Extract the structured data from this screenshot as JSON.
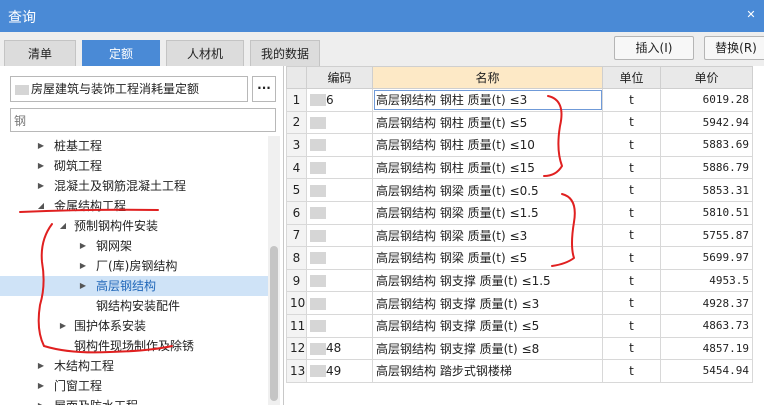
{
  "window": {
    "title": "查询",
    "close_icon": "close-icon"
  },
  "tabs": [
    {
      "label": "清单",
      "active": false
    },
    {
      "label": "定额",
      "active": true
    },
    {
      "label": "人材机",
      "active": false
    },
    {
      "label": "我的数据",
      "active": false
    }
  ],
  "toolbar": {
    "insert_label": "插入(I)",
    "replace_label": "替换(R)"
  },
  "library": {
    "selected": "房屋建筑与装饰工程消耗量定额",
    "more_label": "···"
  },
  "search": {
    "value": "钢"
  },
  "tree": {
    "nodes": [
      {
        "label": "桩基工程",
        "expanded": false
      },
      {
        "label": "砌筑工程",
        "expanded": false
      },
      {
        "label": "混凝土及钢筋混凝土工程",
        "expanded": false
      },
      {
        "label": "金属结构工程",
        "expanded": true
      },
      {
        "label": "预制钢构件安装",
        "expanded": true
      },
      {
        "label": "钢网架",
        "expanded": false
      },
      {
        "label": "厂(库)房钢结构",
        "expanded": false
      },
      {
        "label": "高层钢结构",
        "expanded": false,
        "selected": true
      },
      {
        "label": "钢结构安装配件",
        "expanded": false
      },
      {
        "label": "围护体系安装",
        "expanded": false
      },
      {
        "label": "钢构件现场制作及除锈",
        "expanded": false
      },
      {
        "label": "木结构工程",
        "expanded": false
      },
      {
        "label": "门窗工程",
        "expanded": false
      },
      {
        "label": "屋面及防水工程",
        "expanded": false
      }
    ]
  },
  "table": {
    "headers": {
      "num": "",
      "code": "编码",
      "name": "名称",
      "unit": "单位",
      "price": "单价"
    },
    "rows": [
      {
        "num": "1",
        "code": "6",
        "name": "高层钢结构 钢柱 质量(t) ≤3",
        "unit": "t",
        "price": "6019.28"
      },
      {
        "num": "2",
        "code": "",
        "name": "高层钢结构 钢柱 质量(t) ≤5",
        "unit": "t",
        "price": "5942.94"
      },
      {
        "num": "3",
        "code": "",
        "name": "高层钢结构 钢柱 质量(t) ≤10",
        "unit": "t",
        "price": "5883.69"
      },
      {
        "num": "4",
        "code": "",
        "name": "高层钢结构 钢柱 质量(t) ≤15",
        "unit": "t",
        "price": "5886.79"
      },
      {
        "num": "5",
        "code": "",
        "name": "高层钢结构 钢梁 质量(t) ≤0.5",
        "unit": "t",
        "price": "5853.31"
      },
      {
        "num": "6",
        "code": "",
        "name": "高层钢结构 钢梁 质量(t) ≤1.5",
        "unit": "t",
        "price": "5810.51"
      },
      {
        "num": "7",
        "code": "",
        "name": "高层钢结构 钢梁 质量(t) ≤3",
        "unit": "t",
        "price": "5755.87"
      },
      {
        "num": "8",
        "code": "",
        "name": "高层钢结构 钢梁 质量(t) ≤5",
        "unit": "t",
        "price": "5699.97"
      },
      {
        "num": "9",
        "code": "",
        "name": "高层钢结构 钢支撑 质量(t) ≤1.5",
        "unit": "t",
        "price": "4953.5"
      },
      {
        "num": "10",
        "code": "",
        "name": "高层钢结构 钢支撑 质量(t) ≤3",
        "unit": "t",
        "price": "4928.37"
      },
      {
        "num": "11",
        "code": "",
        "name": "高层钢结构 钢支撑 质量(t) ≤5",
        "unit": "t",
        "price": "4863.73"
      },
      {
        "num": "12",
        "code": "48",
        "name": "高层钢结构 钢支撑 质量(t) ≤8",
        "unit": "t",
        "price": "4857.19"
      },
      {
        "num": "13",
        "code": "49",
        "name": "高层钢结构 踏步式钢楼梯",
        "unit": "t",
        "price": "5454.94"
      }
    ]
  },
  "colors": {
    "accent": "#4a8ad6",
    "annotation": "#e02020",
    "selection": "#cfe3f7"
  }
}
